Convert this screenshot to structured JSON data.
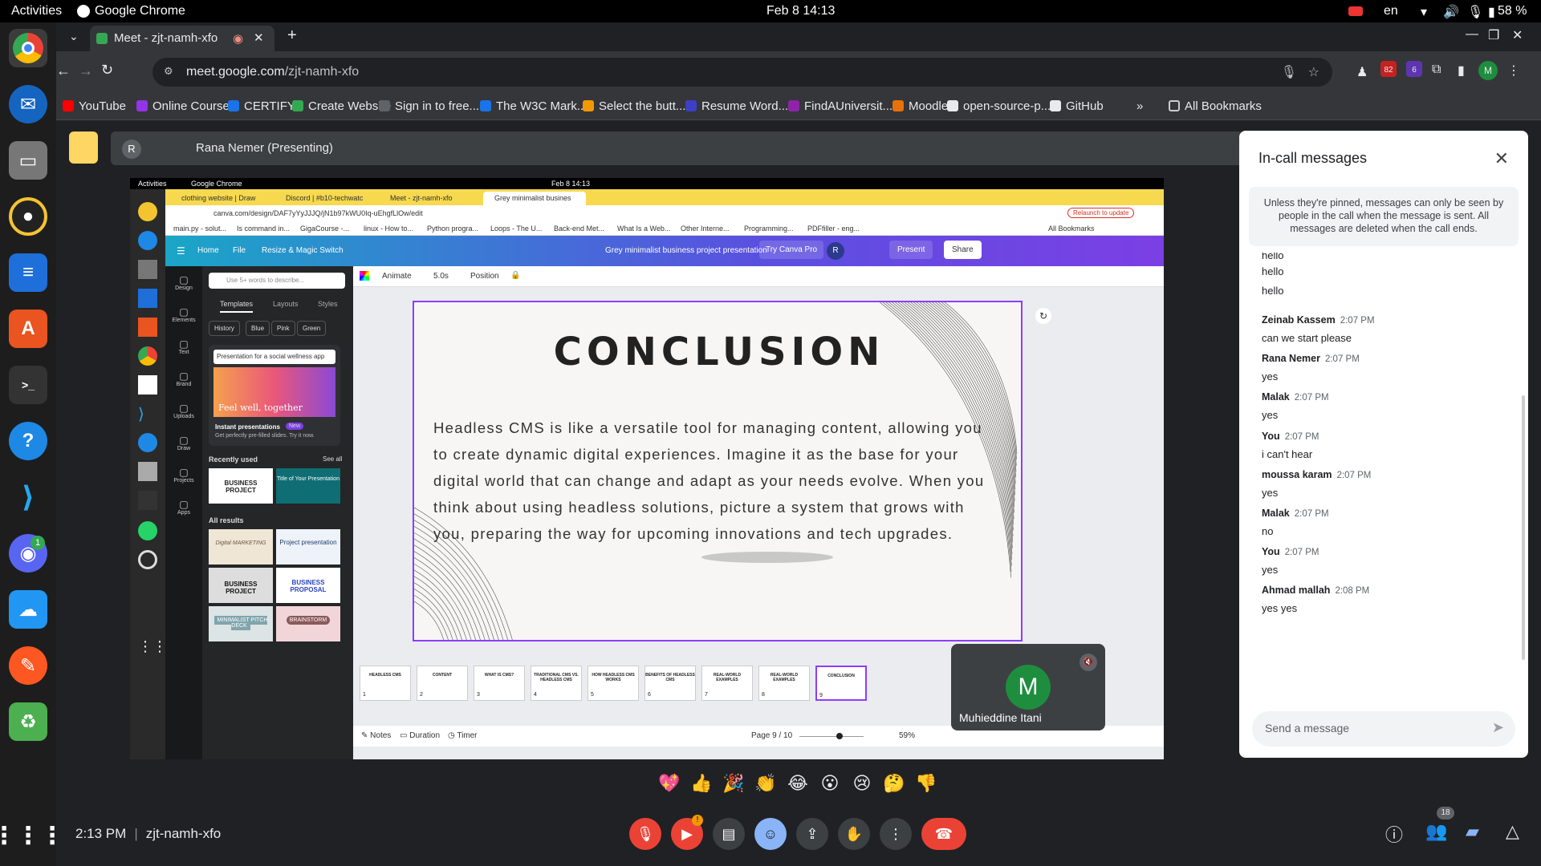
{
  "system": {
    "activities": "Activities",
    "app_name": "Google Chrome",
    "datetime": "Feb 8  14:13",
    "lang": "en",
    "battery": "58 %"
  },
  "chrome": {
    "tab_title": "Meet - zjt-namh-xfo",
    "url_host": "meet.google.com",
    "url_path": "/zjt-namh-xfo",
    "badge_count": "82",
    "ext_count": "6",
    "profile_initial": "M"
  },
  "bookmarks": [
    {
      "label": "YouTube",
      "color": "#ff0000"
    },
    {
      "label": "Online Course...",
      "color": "#9334e6"
    },
    {
      "label": "CERTIFY",
      "color": "#1a73e8"
    },
    {
      "label": "Create Website",
      "color": "#34a853"
    },
    {
      "label": "Sign in to free...",
      "color": "#5f6368"
    },
    {
      "label": "The W3C Mark...",
      "color": "#1a73e8"
    },
    {
      "label": "Select the butt...",
      "color": "#f29900"
    },
    {
      "label": "Resume Word...",
      "color": "#3c40c6"
    },
    {
      "label": "FindAUniversit...",
      "color": "#8e24aa"
    },
    {
      "label": "Moodle",
      "color": "#e8710a"
    },
    {
      "label": "open-source-p...",
      "color": "#e8eaed"
    },
    {
      "label": "GitHub",
      "color": "#e8eaed"
    }
  ],
  "bookmarks_overflow": "»",
  "all_bookmarks": "All Bookmarks",
  "meet": {
    "presenter": "Rana Nemer (Presenting)",
    "presenter_initial": "R",
    "participant_name": "Muhieddine Itani",
    "participant_initial": "M",
    "meeting_code": "zjt-namh-xfo",
    "time": "2:13 PM",
    "participants_count": "18"
  },
  "shared": {
    "activities": "Activities",
    "app": "Google Chrome",
    "datetime": "Feb 8  14:13",
    "tabs": [
      "clothing website | Draw",
      "Discord | #b10-techwatc",
      "Meet - zjt-namh-xfo",
      "Grey minimalist busines"
    ],
    "url": "canva.com/design/DAF7yYyJJJQ/jN1b97kWU0Iq-uEhgfLlOw/edit",
    "relaunch": "Relaunch to update",
    "bookmarks": [
      "main.py - solut...",
      "Is command in...",
      "GigaCourse -...",
      "linux - How to...",
      "Python progra...",
      "Loops - The U...",
      "Back-end Met...",
      "What Is a Web...",
      "Other Interne...",
      "Programming...",
      "PDFfiller - eng...",
      "All Bookmarks"
    ],
    "canva_menu": [
      "Home",
      "File",
      "Resize & Magic Switch"
    ],
    "design_title": "Grey minimalist business project presentation",
    "try_pro": "Try Canva Pro",
    "present": "Present",
    "share": "Share",
    "left_nav": [
      "Design",
      "Elements",
      "Text",
      "Brand",
      "Uploads",
      "Draw",
      "Projects",
      "Apps"
    ],
    "search_placeholder": "Use 5+ words to describe...",
    "panel_tabs": [
      "Templates",
      "Layouts",
      "Styles"
    ],
    "chips": [
      "History",
      "Blue",
      "Pink",
      "Green"
    ],
    "promo_input": "Presentation for a social wellness app",
    "promo_img_text": "Feel well, together",
    "promo_title": "Instant presentations",
    "promo_new": "New",
    "promo_sub": "Get perfectly pre-filled slides. Try it now.",
    "recently_used": "Recently used",
    "see_all": "See all",
    "all_results": "All results",
    "template_cards": [
      "BUSINESS PROJECT",
      "Title of Your Presentation",
      "Digital MARKETING",
      "Project presentation",
      "BUSINESS PROJECT",
      "BUSINESS PROPOSAL",
      "MINIMALIST PITCH DECK",
      "BRAINSTORM"
    ],
    "toolbar": [
      "Animate",
      "5.0s",
      "Position"
    ],
    "slide_title": "CONCLUSION",
    "slide_body": "Headless CMS is like a versatile tool for managing content, allowing you to create dynamic digital experiences. Imagine it as the base for your digital world that can change and adapt as your needs evolve. When you think about using headless solutions, picture a system that grows with you, preparing the way for upcoming innovations and tech upgrades.",
    "thumbs": [
      "HEADLESS CMS",
      "CONTENT",
      "WHAT IS CMS?",
      "TRADITIONAL CMS VS. HEADLESS CMS",
      "HOW HEADLESS CMS WORKS",
      "BENEFITS OF HEADLESS CMS",
      "REAL-WORLD EXAMPLES",
      "REAL-WORLD EXAMPLES",
      "CONCLUSION"
    ],
    "thumb_numbers": [
      "1",
      "2",
      "3",
      "4",
      "5",
      "6",
      "7",
      "8",
      "9"
    ],
    "notes": "Notes",
    "duration": "Duration",
    "timer": "Timer",
    "page": "Page 9 / 10",
    "zoom": "59%"
  },
  "chat": {
    "title": "In-call messages",
    "note": "Unless they're pinned, messages can only be seen by people in the call when the message is sent. All messages are deleted when the call ends.",
    "loose_lines": [
      "hello",
      "hello",
      "hello"
    ],
    "messages": [
      {
        "name": "Zeinab Kassem",
        "time": "2:07 PM",
        "text": "can we start please"
      },
      {
        "name": "Rana Nemer",
        "time": "2:07 PM",
        "text": "yes"
      },
      {
        "name": "Malak",
        "time": "2:07 PM",
        "text": "yes"
      },
      {
        "name": "You",
        "time": "2:07 PM",
        "text": "i can't hear"
      },
      {
        "name": "moussa karam",
        "time": "2:07 PM",
        "text": "yes"
      },
      {
        "name": "Malak",
        "time": "2:07 PM",
        "text": "no"
      },
      {
        "name": "You",
        "time": "2:07 PM",
        "text": "yes"
      },
      {
        "name": "Ahmad mallah",
        "time": "2:08 PM",
        "text": "yes yes"
      }
    ],
    "input_placeholder": "Send a message"
  },
  "reactions": [
    "💖",
    "👍",
    "🎉",
    "👏",
    "😂",
    "😮",
    "😢",
    "🤔",
    "👎"
  ],
  "colors": {
    "meet_bg": "#202124",
    "end_call": "#ea4335",
    "accent_blue": "#8ab4f8",
    "canva_purple": "#8b3dff",
    "present_yellow": "#fdd663"
  }
}
